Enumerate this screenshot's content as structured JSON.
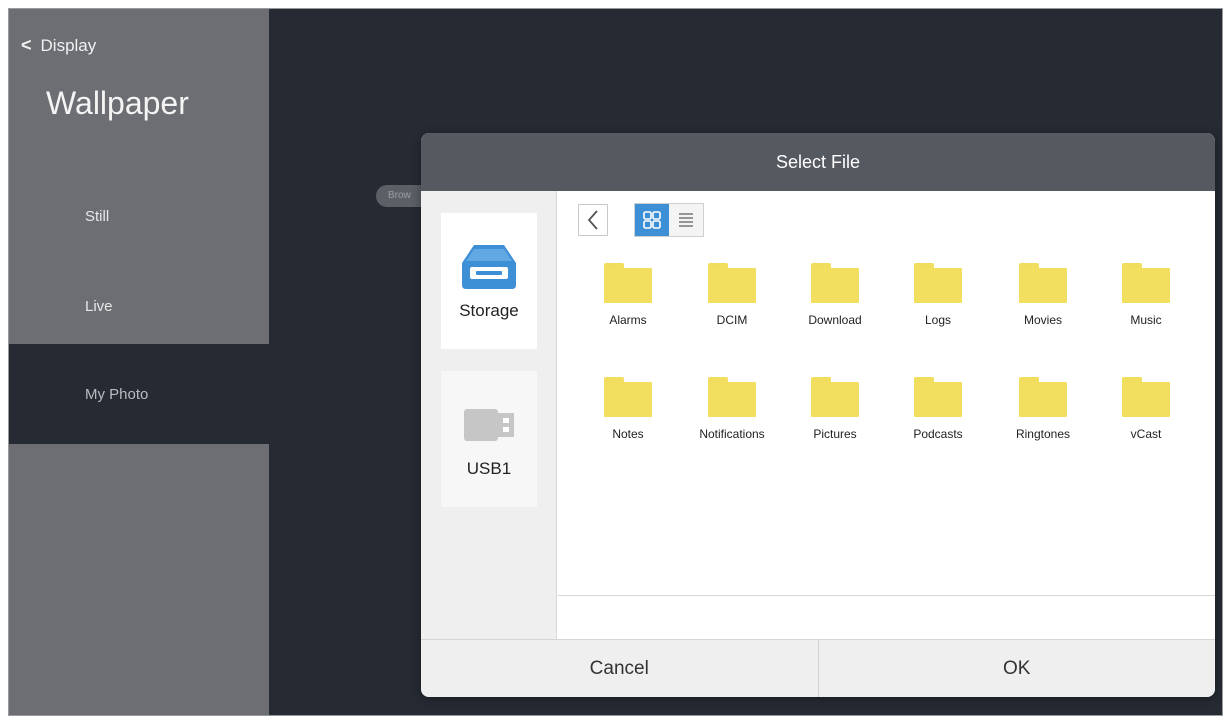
{
  "sidebar": {
    "back_label": "Display",
    "title": "Wallpaper",
    "items": [
      {
        "label": "Still"
      },
      {
        "label": "Live"
      },
      {
        "label": "My Photo"
      }
    ]
  },
  "browse_chip": "Brow",
  "dialog": {
    "title": "Select File",
    "sources": [
      {
        "label": "Storage",
        "icon": "storage-drive-icon"
      },
      {
        "label": "USB1",
        "icon": "usb-drive-icon"
      }
    ],
    "folders": [
      {
        "name": "Alarms"
      },
      {
        "name": "DCIM"
      },
      {
        "name": "Download"
      },
      {
        "name": "Logs"
      },
      {
        "name": "Movies"
      },
      {
        "name": "Music"
      },
      {
        "name": "Notes"
      },
      {
        "name": "Notifications"
      },
      {
        "name": "Pictures"
      },
      {
        "name": "Podcasts"
      },
      {
        "name": "Ringtones"
      },
      {
        "name": "vCast"
      }
    ],
    "cancel_label": "Cancel",
    "ok_label": "OK"
  },
  "colors": {
    "background": "#262a33",
    "sidebar": "#6c6e73",
    "dialog_header": "#555960",
    "accent": "#3d8fd6",
    "folder": "#f3df5f",
    "storage_icon": "#3d8fd6"
  }
}
